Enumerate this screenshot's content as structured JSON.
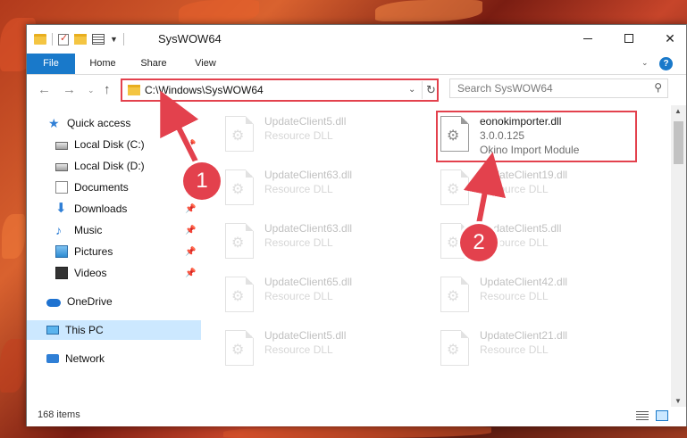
{
  "window": {
    "title": "SysWOW64"
  },
  "ribbon": {
    "tabs": [
      "File",
      "Home",
      "Share",
      "View"
    ]
  },
  "address_bar": {
    "path": "C:\\Windows\\SysWOW64"
  },
  "search": {
    "placeholder": "Search SysWOW64"
  },
  "navigation_pane": {
    "items": [
      {
        "label": "Quick access",
        "icon": "star-icon",
        "pinned": false
      },
      {
        "label": "Local Disk (C:)",
        "icon": "drive-icon",
        "pinned": true
      },
      {
        "label": "Local Disk (D:)",
        "icon": "drive-icon",
        "pinned": false
      },
      {
        "label": "Documents",
        "icon": "documents-icon",
        "pinned": false
      },
      {
        "label": "Downloads",
        "icon": "download-icon",
        "pinned": true
      },
      {
        "label": "Music",
        "icon": "music-icon",
        "pinned": true
      },
      {
        "label": "Pictures",
        "icon": "pictures-icon",
        "pinned": true
      },
      {
        "label": "Videos",
        "icon": "videos-icon",
        "pinned": true
      },
      {
        "label": "OneDrive",
        "icon": "cloud-icon",
        "pinned": false
      },
      {
        "label": "This PC",
        "icon": "computer-icon",
        "pinned": false,
        "selected": true
      },
      {
        "label": "Network",
        "icon": "network-icon",
        "pinned": false
      }
    ]
  },
  "files": {
    "highlighted": {
      "name": "eonokimporter.dll",
      "version": "3.0.0.125",
      "description": "Okino Import Module"
    },
    "left_column": [
      {
        "name": "UpdateClient5.dll",
        "type": "Resource DLL"
      },
      {
        "name": "UpdateClient63.dll",
        "type": "Resource DLL"
      },
      {
        "name": "UpdateClient63.dll",
        "type": "Resource DLL"
      },
      {
        "name": "UpdateClient65.dll",
        "type": "Resource DLL"
      },
      {
        "name": "UpdateClient5.dll",
        "type": "Resource DLL"
      }
    ],
    "right_column": [
      {
        "name": "UpdateClient19.dll",
        "type": "Resource DLL"
      },
      {
        "name": "UpdateClient5.dll",
        "type": "Resource DLL"
      },
      {
        "name": "UpdateClient42.dll",
        "type": "Resource DLL"
      },
      {
        "name": "UpdateClient21.dll",
        "type": "Resource DLL"
      }
    ]
  },
  "status_bar": {
    "item_count": "168 items"
  },
  "annotations": {
    "marker_1": "1",
    "marker_2": "2"
  },
  "colors": {
    "accent": "#1979ca",
    "highlight": "#e3414d",
    "selection": "#cce8ff"
  }
}
